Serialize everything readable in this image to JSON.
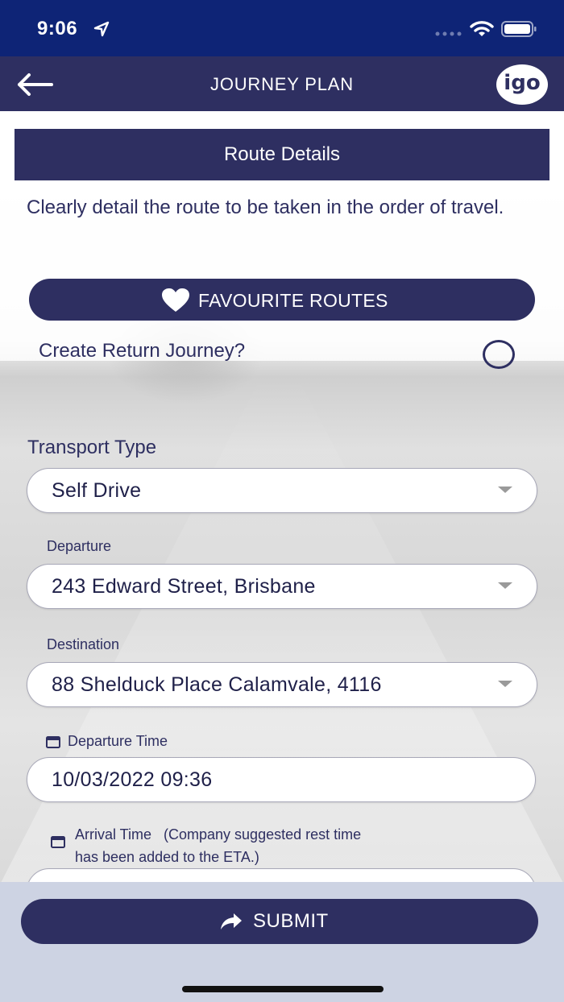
{
  "status_bar": {
    "time": "9:06"
  },
  "nav": {
    "title": "JOURNEY PLAN",
    "logo_text": "igo"
  },
  "section": {
    "title": "Route Details"
  },
  "instruction": "Clearly detail the route to be taken in the order of travel.",
  "favourite_routes": {
    "label": "FAVOURITE ROUTES"
  },
  "return_journey": {
    "label": "Create Return Journey?",
    "checked": false
  },
  "transport": {
    "label": "Transport Type",
    "value": "Self Drive"
  },
  "departure": {
    "label": "Departure",
    "value": "243 Edward Street, Brisbane"
  },
  "destination": {
    "label": "Destination",
    "value": "88 Shelduck Place Calamvale, 4116"
  },
  "departure_time": {
    "label": "Departure Time",
    "value": "10/03/2022 09:36"
  },
  "arrival_time": {
    "label_line1": "Arrival Time   (Company suggested rest time",
    "label_line2": "has been added to the ETA.)"
  },
  "submit": {
    "label": "SUBMIT"
  },
  "colors": {
    "primary": "#2e2f61",
    "status_bar": "#0e2476",
    "bottom_panel": "#cdd3e3"
  }
}
